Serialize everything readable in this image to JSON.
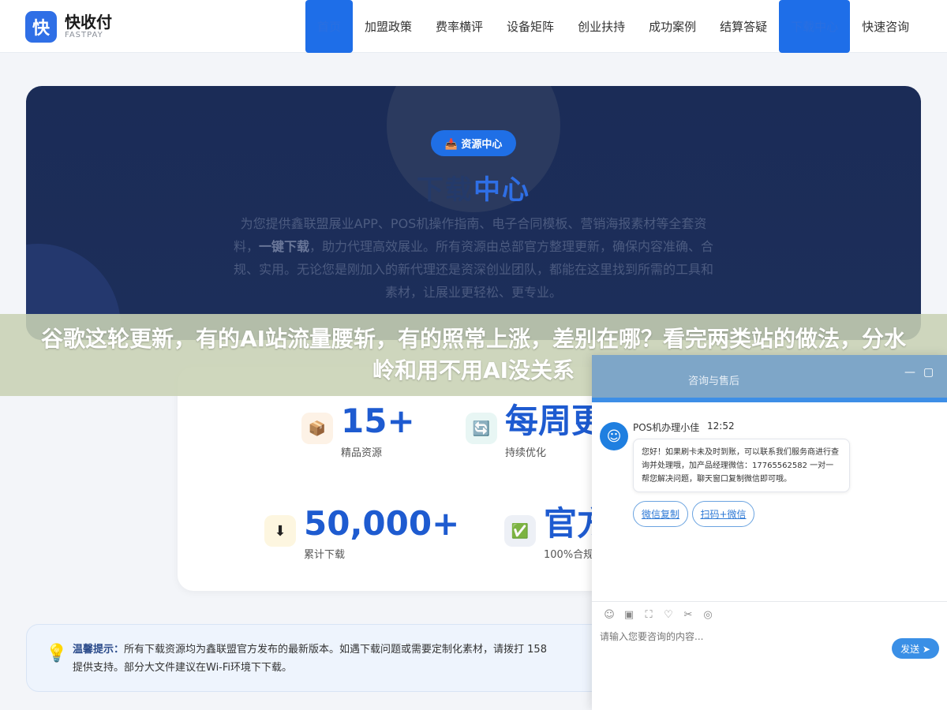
{
  "header": {
    "logo_mark": "快",
    "logo_name": "快收付",
    "logo_sub": "FASTPAY",
    "nav": [
      {
        "label": "首页",
        "active": true
      },
      {
        "label": "加盟政策",
        "active": false
      },
      {
        "label": "费率横评",
        "active": false
      },
      {
        "label": "设备矩阵",
        "active": false
      },
      {
        "label": "创业扶持",
        "active": false
      },
      {
        "label": "成功案例",
        "active": false
      },
      {
        "label": "结算答疑",
        "active": false
      },
      {
        "label": "下载中心",
        "active": true
      },
      {
        "label": "快速咨询",
        "active": false
      }
    ]
  },
  "hero": {
    "badge": "📥 资源中心",
    "title_a": "下载",
    "title_b": "中心",
    "desc_1": "为您提供鑫联盟展业APP、POS机操作指南、电子合同模板、营销海报素材等全套资料，",
    "desc_bold": "一键下载",
    "desc_2": "，助力代理高效展业。所有资源由总部官方整理更新，确保内容准确、合规、实用。无论您是刚加入的新代理还是资深创业团队，都能在这里找到所需的工具和素材，让展业更轻松、更专业。"
  },
  "banner": {
    "text": "谷歌这轮更新，有的AI站流量腰斩，有的照常上涨，差别在哪？看完两类站的做法，分水岭和用不用AI没关系"
  },
  "stats": [
    {
      "icon": "📦",
      "value": "15+",
      "label": "精品资源",
      "bg": "#fdf2e6"
    },
    {
      "icon": "🔄",
      "value": "每周更",
      "label": "持续优化",
      "bg": "#e8f6f4"
    },
    {
      "icon": "⬇",
      "value": "50,000+",
      "label": "累计下载",
      "bg": "#fdf6e0"
    },
    {
      "icon": "✅",
      "value": "官方",
      "label": "100%合规",
      "bg": "#edf0f6"
    }
  ],
  "tip": {
    "title": "温馨提示：",
    "text_1": "所有下载资源均为鑫联盟官方发布的最新版本。如遇下载问题或需要定制化素材，请拨打 158",
    "text_2": "提供支持。部分大文件建议在Wi-Fi环境下下载。"
  },
  "chat": {
    "title": "咨询与售后",
    "minimize": "—",
    "maximize": "▢",
    "agent_name": "POS机办理小佳",
    "time": "12:52",
    "message": "您好！如果刷卡未及时到账，可以联系我们服务商进行查询并处理哦，加产品经理微信：17765562582 一对一帮您解决问题，聊天窗口复制微信即可哦。",
    "chip_1": "微信复制",
    "chip_2": "扫码+微信",
    "input_placeholder": "请输入您要咨询的内容...",
    "send_label": "发送 ➤",
    "tools": [
      "☺",
      "▣",
      "⛶",
      "♡",
      "✂",
      "◎"
    ]
  }
}
